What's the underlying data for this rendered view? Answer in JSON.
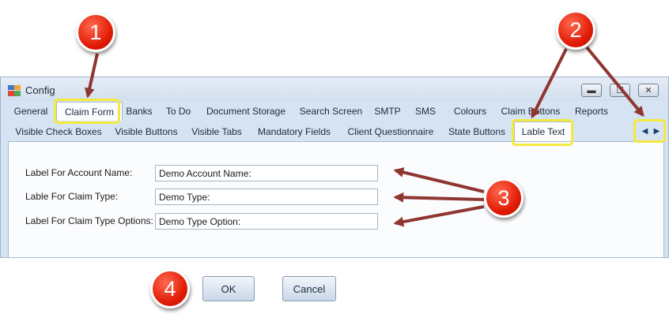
{
  "window": {
    "title": "Config",
    "controls": {
      "minimize": "▬",
      "maximize": "☐",
      "close": "✕"
    }
  },
  "tabs_primary": [
    {
      "label": "General"
    },
    {
      "label": "Claim Form",
      "active": true
    },
    {
      "label": "Banks"
    },
    {
      "label": "To Do"
    },
    {
      "label": "Document Storage"
    },
    {
      "label": "Search Screen"
    },
    {
      "label": "SMTP"
    },
    {
      "label": "SMS"
    },
    {
      "label": "Colours"
    },
    {
      "label": "Claim Buttons"
    },
    {
      "label": "Reports"
    }
  ],
  "tabs_secondary": [
    {
      "label": "Visible Check Boxes"
    },
    {
      "label": "Visible Buttons"
    },
    {
      "label": "Visible Tabs"
    },
    {
      "label": "Mandatory Fields"
    },
    {
      "label": "Client Questionnaire"
    },
    {
      "label": "State Buttons"
    },
    {
      "label": "Lable Text",
      "active": true
    }
  ],
  "tab_scroll": {
    "left": "◀",
    "right": "▶"
  },
  "form": {
    "fields": [
      {
        "label": "Label For Account Name:",
        "value": "Demo Account Name:"
      },
      {
        "label": "Lable For Claim Type:",
        "value": "Demo Type:"
      },
      {
        "label": "Label For Claim Type Options:",
        "value": "Demo Type Option:"
      }
    ]
  },
  "buttons": {
    "ok": "OK",
    "cancel": "Cancel"
  },
  "callouts": {
    "one": "1",
    "two": "2",
    "three": "3",
    "four": "4"
  },
  "colors": {
    "highlight": "#f3ea3c",
    "badge_red": "#e11b06",
    "arrow": "#8f3630",
    "window_bg": "#d6e3f2"
  }
}
